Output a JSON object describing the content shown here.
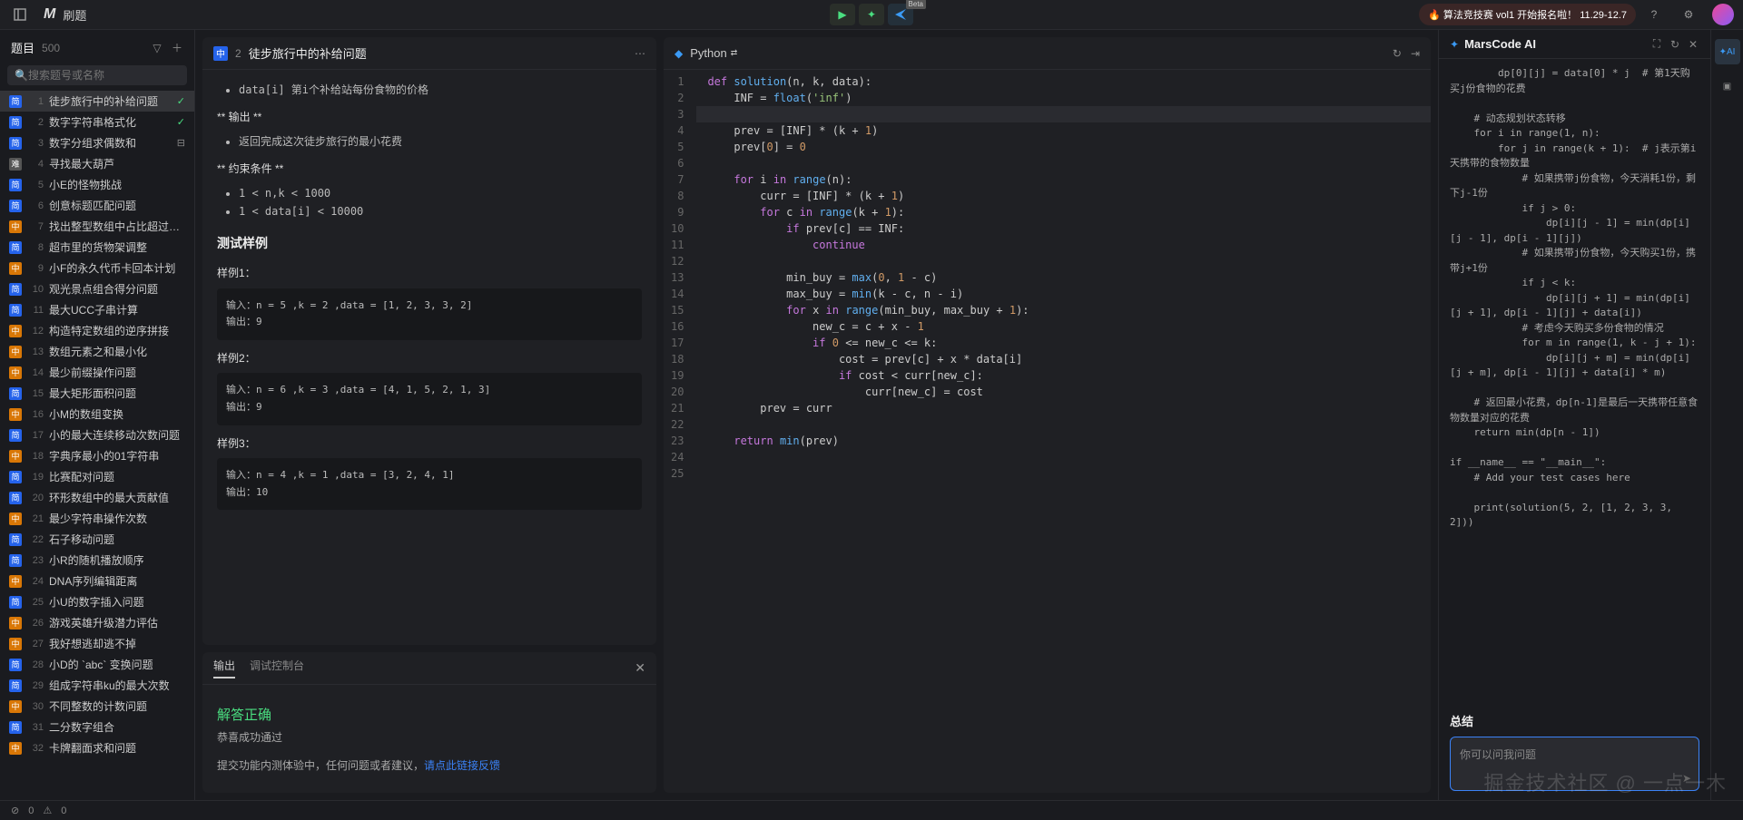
{
  "header": {
    "title": "刷题",
    "promo": "🔥 算法竞技赛 vol1 开始报名啦！ 11.29-12.7",
    "beta": "Beta"
  },
  "sidebar": {
    "heading": "题目",
    "count": "500",
    "search_placeholder": "搜索题号或名称",
    "items": [
      {
        "n": "1",
        "d": "e",
        "name": "徒步旅行中的补给问题",
        "state": "done",
        "active": true
      },
      {
        "n": "2",
        "d": "e",
        "name": "数字字符串格式化",
        "state": "done"
      },
      {
        "n": "3",
        "d": "e",
        "name": "数字分组求偶数和",
        "state": "ex"
      },
      {
        "n": "4",
        "d": "h",
        "name": "寻找最大葫芦"
      },
      {
        "n": "5",
        "d": "e",
        "name": "小E的怪物挑战"
      },
      {
        "n": "6",
        "d": "e",
        "name": "创意标题匹配问题"
      },
      {
        "n": "7",
        "d": "m",
        "name": "找出整型数组中占比超过一半的数"
      },
      {
        "n": "8",
        "d": "e",
        "name": "超市里的货物架调整"
      },
      {
        "n": "9",
        "d": "m",
        "name": "小F的永久代币卡回本计划"
      },
      {
        "n": "10",
        "d": "e",
        "name": "观光景点组合得分问题"
      },
      {
        "n": "11",
        "d": "e",
        "name": "最大UCC子串计算"
      },
      {
        "n": "12",
        "d": "m",
        "name": "构造特定数组的逆序拼接"
      },
      {
        "n": "13",
        "d": "m",
        "name": "数组元素之和最小化"
      },
      {
        "n": "14",
        "d": "m",
        "name": "最少前缀操作问题"
      },
      {
        "n": "15",
        "d": "e",
        "name": "最大矩形面积问题"
      },
      {
        "n": "16",
        "d": "m",
        "name": "小M的数组变换"
      },
      {
        "n": "17",
        "d": "e",
        "name": "小的最大连续移动次数问题"
      },
      {
        "n": "18",
        "d": "m",
        "name": "字典序最小的01字符串"
      },
      {
        "n": "19",
        "d": "e",
        "name": "比赛配对问题"
      },
      {
        "n": "20",
        "d": "e",
        "name": "环形数组中的最大贡献值"
      },
      {
        "n": "21",
        "d": "m",
        "name": "最少字符串操作次数"
      },
      {
        "n": "22",
        "d": "e",
        "name": "石子移动问题"
      },
      {
        "n": "23",
        "d": "e",
        "name": "小R的随机播放顺序"
      },
      {
        "n": "24",
        "d": "m",
        "name": "DNA序列编辑距离"
      },
      {
        "n": "25",
        "d": "e",
        "name": "小U的数字插入问题"
      },
      {
        "n": "26",
        "d": "m",
        "name": "游戏英雄升级潜力评估"
      },
      {
        "n": "27",
        "d": "m",
        "name": "我好想逃却逃不掉"
      },
      {
        "n": "28",
        "d": "e",
        "name": "小D的 `abc` 变换问题"
      },
      {
        "n": "29",
        "d": "e",
        "name": "组成字符串ku的最大次数"
      },
      {
        "n": "30",
        "d": "m",
        "name": "不同整数的计数问题"
      },
      {
        "n": "31",
        "d": "e",
        "name": "二分数字组合"
      },
      {
        "n": "32",
        "d": "m",
        "name": "卡牌翻面求和问题"
      }
    ]
  },
  "problem": {
    "number": "2",
    "title": "徒步旅行中的补给问题",
    "code_note": "data[i]  第i个补给站每份食物的价格",
    "output_heading": "** 输出 **",
    "output_desc": "返回完成这次徒步旅行的最小花费",
    "constraint_heading": "** 约束条件 **",
    "constraints": [
      "1 < n,k < 1000",
      "1 < data[i] < 10000"
    ],
    "test_heading": "测试样例",
    "ex1_label": "样例1：",
    "ex1_in": "输入：n = 5 ,k = 2 ,data = [1, 2, 3, 3, 2]",
    "ex1_out": "输出：9",
    "ex2_label": "样例2：",
    "ex2_in": "输入：n = 6 ,k = 3 ,data = [4, 1, 5, 2, 1, 3]",
    "ex2_out": "输出：9",
    "ex3_label": "样例3：",
    "ex3_in": "输入：n = 4 ,k = 1 ,data = [3, 2, 4, 1]",
    "ex3_out": "输出：10"
  },
  "editor": {
    "language": "Python",
    "lines": [
      "def solution(n, k, data):",
      "    INF = float('inf')",
      "",
      "    prev = [INF] * (k + 1)",
      "    prev[0] = 0",
      "",
      "    for i in range(n):",
      "        curr = [INF] * (k + 1)",
      "        for c in range(k + 1):",
      "            if prev[c] == INF:",
      "                continue",
      "",
      "            min_buy = max(0, 1 - c)",
      "            max_buy = min(k - c, n - i)",
      "            for x in range(min_buy, max_buy + 1):",
      "                new_c = c + x - 1",
      "                if 0 <= new_c <= k:",
      "                    cost = prev[c] + x * data[i]",
      "                    if cost < curr[new_c]:",
      "                        curr[new_c] = cost",
      "        prev = curr",
      "",
      "    return min(prev)",
      "",
      ""
    ]
  },
  "output": {
    "tab1": "输出",
    "tab2": "调试控制台",
    "success": "解答正确",
    "pass": "恭喜成功通过",
    "feedback_prefix": "提交功能内测体验中，任何问题或者建议，",
    "feedback_link": "请点此链接反馈"
  },
  "ai": {
    "title": "MarsCode AI",
    "code": "        dp[0][j] = data[0] * j  # 第1天购买j份食物的花费\n\n    # 动态规划状态转移\n    for i in range(1, n):\n        for j in range(k + 1):  # j表示第i天携带的食物数量\n            # 如果携带j份食物，今天消耗1份，剩下j-1份\n            if j > 0:\n                dp[i][j - 1] = min(dp[i][j - 1], dp[i - 1][j])\n            # 如果携带j份食物，今天购买1份，携带j+1份\n            if j < k:\n                dp[i][j + 1] = min(dp[i][j + 1], dp[i - 1][j] + data[i])\n            # 考虑今天购买多份食物的情况\n            for m in range(1, k - j + 1):\n                dp[i][j + m] = min(dp[i][j + m], dp[i - 1][j] + data[i] * m)\n\n    # 返回最小花费，dp[n-1]是最后一天携带任意食物数量对应的花费\n    return min(dp[n - 1])\n\nif __name__ == \"__main__\":\n    # Add your test cases here\n\n    print(solution(5, 2, [1, 2, 3, 3, 2]))",
    "summary": "总结",
    "input_placeholder": "你可以问我问题"
  },
  "rail": {
    "ai": "AI"
  },
  "statusbar": {
    "err": "0",
    "warn": "0"
  },
  "watermark": "掘金技术社区 @ 一点一木"
}
